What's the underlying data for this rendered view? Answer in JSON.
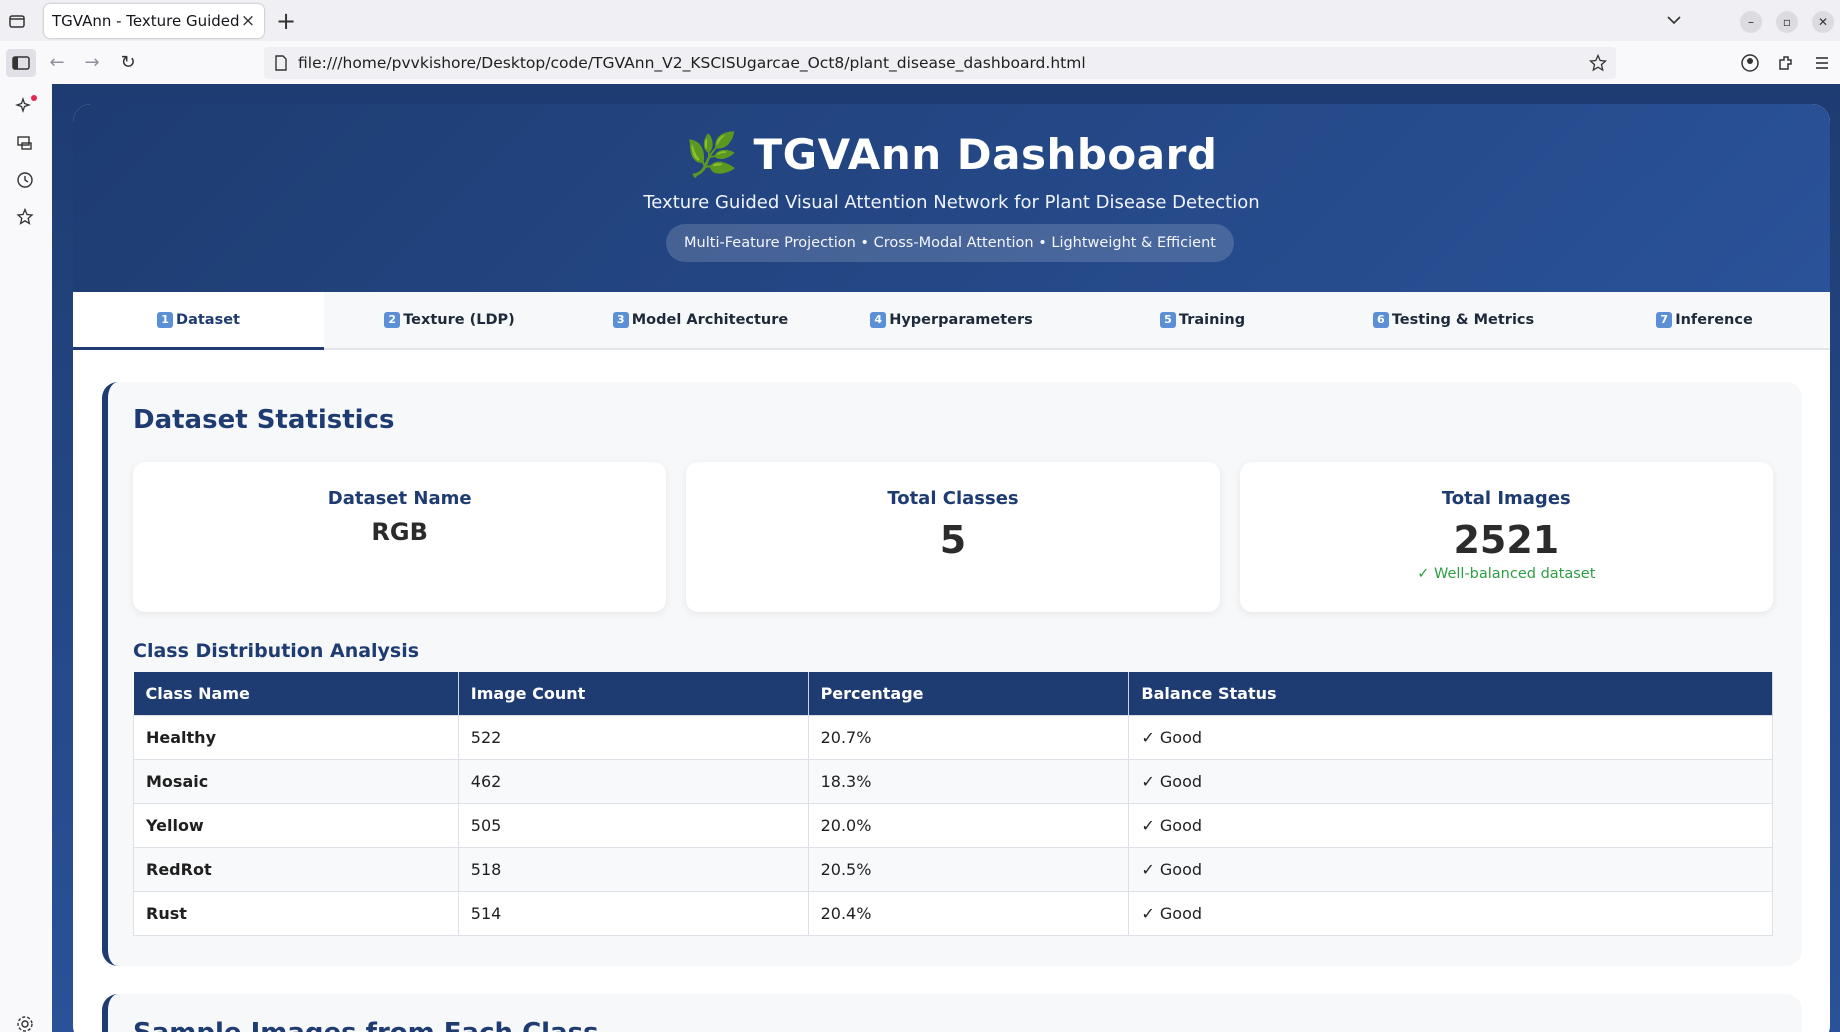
{
  "browser": {
    "tab_title": "TGVAnn - Texture Guided Vis",
    "url": "file:///home/pvvkishore/Desktop/code/TGVAnn_V2_KSCISUgarcae_Oct8/plant_disease_dashboard.html"
  },
  "header": {
    "emoji": "🌿",
    "title": "TGVAnn Dashboard",
    "subtitle": "Texture Guided Visual Attention Network for Plant Disease Detection",
    "tagline": "Multi-Feature Projection • Cross-Modal Attention • Lightweight & Efficient"
  },
  "nav": {
    "tabs": [
      {
        "num": "1",
        "label": "Dataset"
      },
      {
        "num": "2",
        "label": "Texture (LDP)"
      },
      {
        "num": "3",
        "label": "Model Architecture"
      },
      {
        "num": "4",
        "label": "Hyperparameters"
      },
      {
        "num": "5",
        "label": "Training"
      },
      {
        "num": "6",
        "label": "Testing & Metrics"
      },
      {
        "num": "7",
        "label": "Inference"
      }
    ],
    "active": "Dataset"
  },
  "stats": {
    "heading": "Dataset Statistics",
    "dataset_name_label": "Dataset Name",
    "dataset_name": "RGB",
    "classes_label": "Total Classes",
    "classes": "5",
    "images_label": "Total Images",
    "images": "2521",
    "balance_note": "✓ Well-balanced dataset"
  },
  "distribution": {
    "heading": "Class Distribution Analysis",
    "columns": [
      "Class Name",
      "Image Count",
      "Percentage",
      "Balance Status"
    ],
    "rows": [
      {
        "name": "Healthy",
        "count": "522",
        "pct": "20.7%",
        "status": "✓ Good"
      },
      {
        "name": "Mosaic",
        "count": "462",
        "pct": "18.3%",
        "status": "✓ Good"
      },
      {
        "name": "Yellow",
        "count": "505",
        "pct": "20.0%",
        "status": "✓ Good"
      },
      {
        "name": "RedRot",
        "count": "518",
        "pct": "20.5%",
        "status": "✓ Good"
      },
      {
        "name": "Rust",
        "count": "514",
        "pct": "20.4%",
        "status": "✓ Good"
      }
    ]
  },
  "samples": {
    "heading": "Sample Images from Each Class"
  },
  "colors": {
    "primary": "#1e3c72",
    "accent": "#2a5298",
    "success": "#2e9e44"
  }
}
